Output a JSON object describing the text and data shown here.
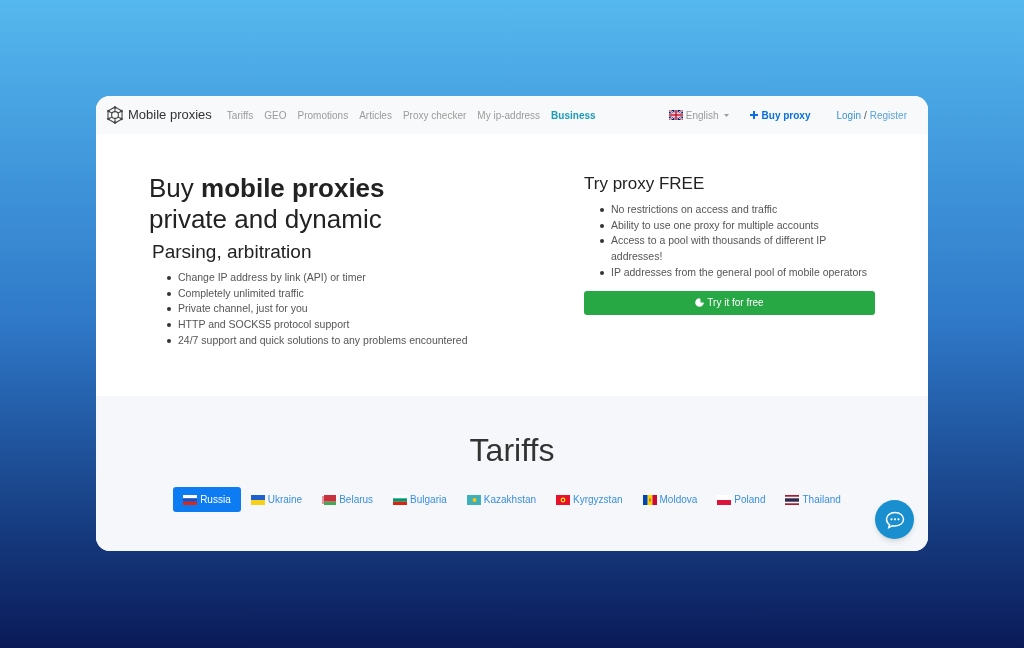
{
  "nav": {
    "brand": "Mobile proxies",
    "links": [
      {
        "label": "Tariffs",
        "highlighted": false
      },
      {
        "label": "GEO",
        "highlighted": false
      },
      {
        "label": "Promotions",
        "highlighted": false
      },
      {
        "label": "Articles",
        "highlighted": false
      },
      {
        "label": "Proxy checker",
        "highlighted": false
      },
      {
        "label": "My ip-address",
        "highlighted": false
      },
      {
        "label": "Business",
        "highlighted": true
      }
    ],
    "language": "English",
    "buy_button": "Buy proxy",
    "login": "Login",
    "separator": "/",
    "register": "Register"
  },
  "hero": {
    "title": [
      "Buy **mobile proxies**",
      "private and dynamic"
    ],
    "subtitle": "Parsing, arbitration",
    "features": [
      "Change IP address by link (API) or timer",
      "Completely unlimited traffic",
      "Private channel, just for you",
      "HTTP and SOCKS5 protocol support",
      "24/7 support and quick solutions to any problems encountered"
    ]
  },
  "trial": {
    "title": "Try proxy FREE",
    "features": [
      "No restrictions on access and traffic",
      "Ability to use one proxy for multiple accounts",
      "Access to a pool with thousands of different IP addresses!",
      "IP addresses from the general pool of mobile operators"
    ],
    "button": "Try it for free"
  },
  "tariffs": {
    "title": "Tariffs",
    "countries": [
      {
        "label": "Russia",
        "selected": true
      },
      {
        "label": "Ukraine",
        "selected": false
      },
      {
        "label": "Belarus",
        "selected": false
      },
      {
        "label": "Bulgaria",
        "selected": false
      },
      {
        "label": "Kazakhstan",
        "selected": false
      },
      {
        "label": "Kyrgyzstan",
        "selected": false
      },
      {
        "label": "Moldova",
        "selected": false
      },
      {
        "label": "Poland",
        "selected": false
      },
      {
        "label": "Thailand",
        "selected": false
      }
    ]
  }
}
